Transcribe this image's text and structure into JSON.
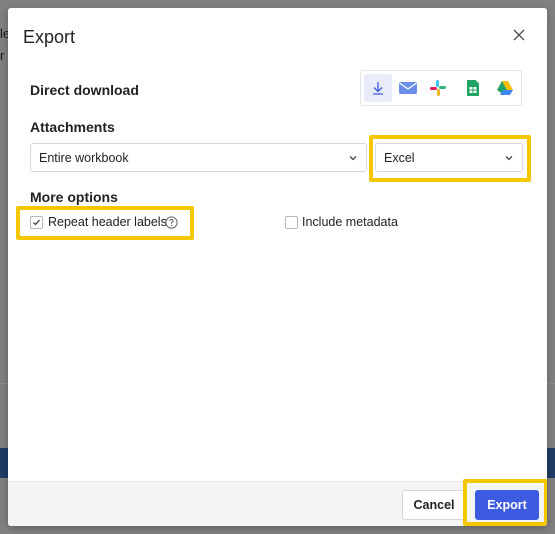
{
  "background": {
    "fragments": [
      "le",
      "r r"
    ]
  },
  "dialog": {
    "title": "Export",
    "direct_download": {
      "label": "Direct download",
      "destinations": [
        {
          "icon": "download-icon",
          "active": true
        },
        {
          "icon": "email-icon",
          "active": false
        },
        {
          "icon": "slack-icon",
          "active": false
        },
        {
          "icon": "google-sheets-icon",
          "active": false
        },
        {
          "icon": "google-drive-icon",
          "active": false
        }
      ]
    },
    "attachments": {
      "label": "Attachments",
      "scope_value": "Entire workbook",
      "format_value": "Excel"
    },
    "more_options": {
      "label": "More options",
      "repeat_header_labels": {
        "label": "Repeat header labels",
        "checked": true
      },
      "include_metadata": {
        "label": "Include metadata",
        "checked": false
      }
    },
    "footer": {
      "cancel_label": "Cancel",
      "export_label": "Export"
    }
  },
  "colors": {
    "accent": "#3d5be0",
    "highlight": "#f4c800",
    "active_destination_bg": "#e7ecf8"
  }
}
